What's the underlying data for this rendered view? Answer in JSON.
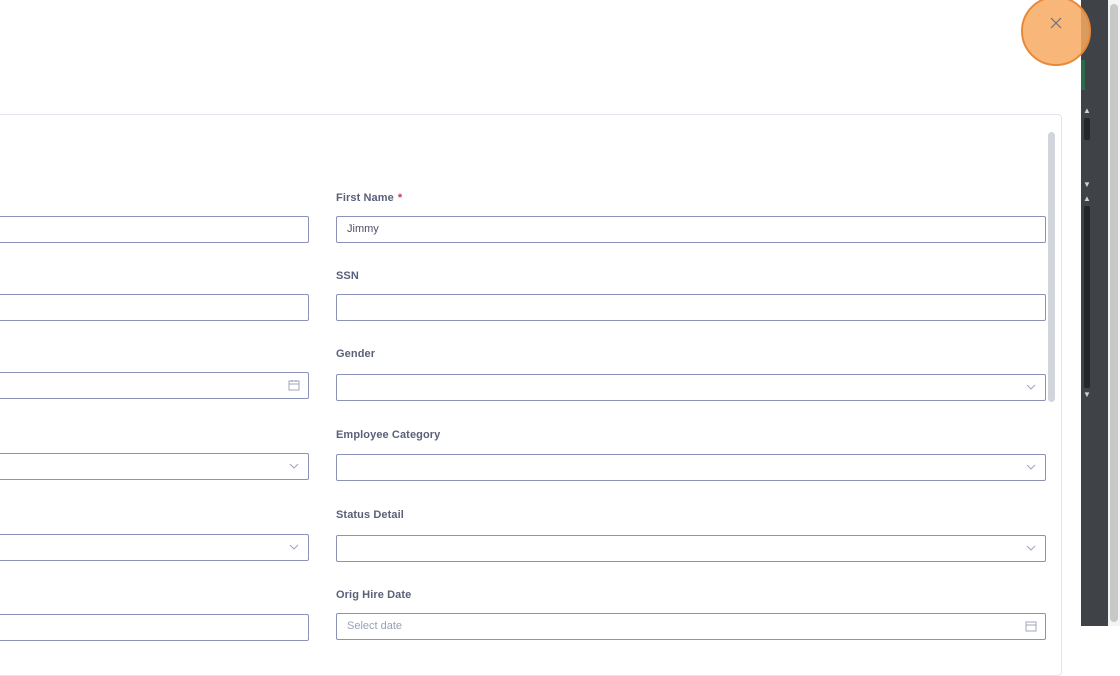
{
  "dialog": {
    "close_icon": "close-icon"
  },
  "form": {
    "first_name": {
      "label": "First Name",
      "required_mark": "*",
      "value": "Jimmy"
    },
    "ssn": {
      "label": "SSN",
      "value": ""
    },
    "gender": {
      "label": "Gender",
      "value": ""
    },
    "employee_category": {
      "label": "Employee Category",
      "value": ""
    },
    "status_detail": {
      "label": "Status Detail",
      "value": ""
    },
    "orig_hire_date": {
      "label": "Orig Hire Date",
      "placeholder": "Select date"
    }
  },
  "colors": {
    "field_border": "#8b92b8",
    "label": "#5a607a",
    "required": "#d2324b",
    "highlight": "#f7aa61"
  }
}
